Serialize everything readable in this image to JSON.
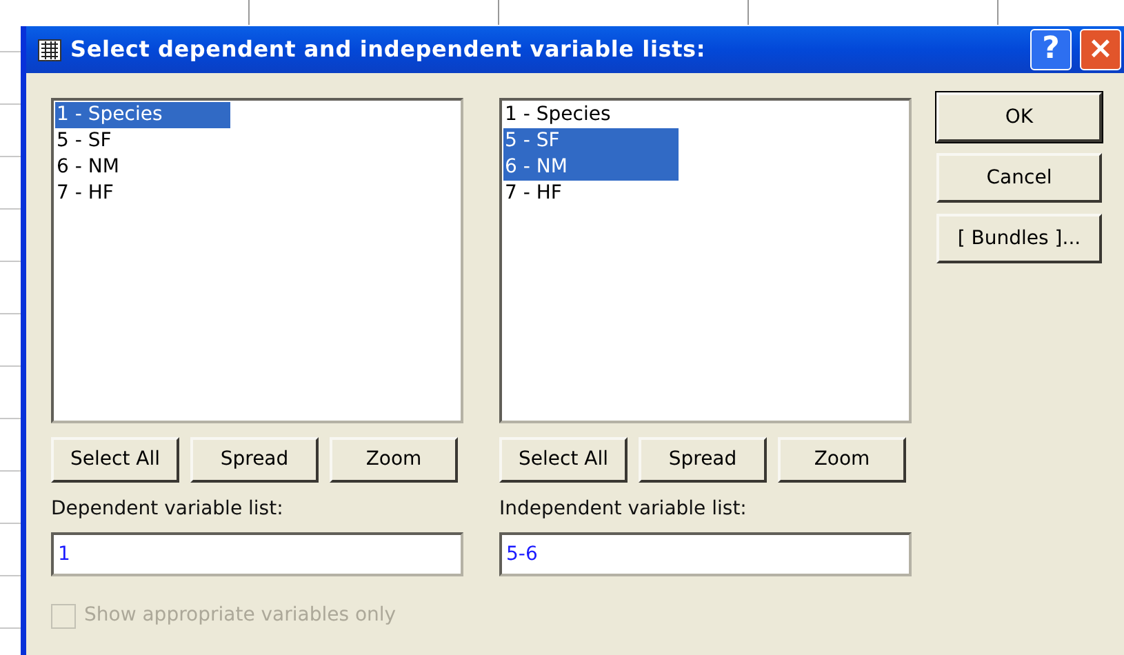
{
  "window": {
    "title": "Select dependent and independent variable lists:",
    "buttons": [
      "?",
      "×"
    ]
  },
  "lists": [
    {
      "items": [
        {
          "label": "1 - Species",
          "selected": true
        },
        {
          "label": "5 - SF",
          "selected": false
        },
        {
          "label": "6 - NM",
          "selected": false
        },
        {
          "label": "7 - HF",
          "selected": false
        }
      ],
      "buttons": [
        "Select All",
        "Spread",
        "Zoom"
      ],
      "field_label": "Dependent variable list:",
      "value": "1"
    },
    {
      "items": [
        {
          "label": "1 - Species",
          "selected": false
        },
        {
          "label": "5 - SF",
          "selected": true
        },
        {
          "label": "6 - NM",
          "selected": true
        },
        {
          "label": "7 - HF",
          "selected": false
        }
      ],
      "buttons": [
        "Select All",
        "Spread",
        "Zoom"
      ],
      "field_label": "Independent variable list:",
      "value": "5-6"
    }
  ],
  "side_buttons": [
    {
      "label": "OK",
      "default": true
    },
    {
      "label": "Cancel",
      "default": false
    },
    {
      "label": "[ Bundles ]...",
      "default": false
    }
  ],
  "checkbox": {
    "label": "Show appropriate variables only",
    "checked": false,
    "disabled": true
  }
}
